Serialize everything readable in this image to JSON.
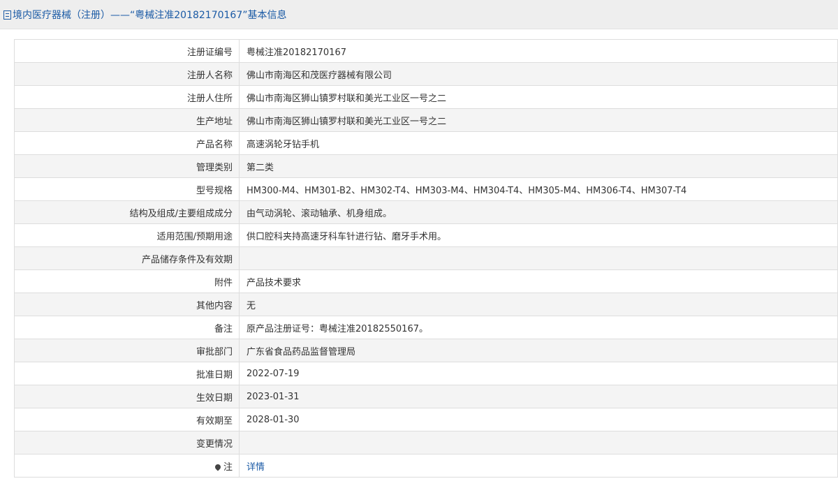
{
  "header": {
    "title": "境内医疗器械（注册）——“粤械注准20182170167”基本信息"
  },
  "rows": [
    {
      "label": "注册证编号",
      "value": "粤械注准20182170167"
    },
    {
      "label": "注册人名称",
      "value": "佛山市南海区和茂医疗器械有限公司"
    },
    {
      "label": "注册人住所",
      "value": "佛山市南海区狮山镇罗村联和美光工业区一号之二"
    },
    {
      "label": "生产地址",
      "value": "佛山市南海区狮山镇罗村联和美光工业区一号之二"
    },
    {
      "label": "产品名称",
      "value": "高速涡轮牙钻手机"
    },
    {
      "label": "管理类别",
      "value": "第二类"
    },
    {
      "label": "型号规格",
      "value": "HM300-M4、HM301-B2、HM302-T4、HM303-M4、HM304-T4、HM305-M4、HM306-T4、HM307-T4"
    },
    {
      "label": "结构及组成/主要组成成分",
      "value": "由气动涡轮、滚动轴承、机身组成。"
    },
    {
      "label": "适用范围/预期用途",
      "value": "供口腔科夹持高速牙科车针进行钻、磨牙手术用。"
    },
    {
      "label": "产品储存条件及有效期",
      "value": ""
    },
    {
      "label": "附件",
      "value": "产品技术要求"
    },
    {
      "label": "其他内容",
      "value": "无"
    },
    {
      "label": "备注",
      "value": "原产品注册证号：粤械注准20182550167。"
    },
    {
      "label": "审批部门",
      "value": "广东省食品药品监督管理局"
    },
    {
      "label": "批准日期",
      "value": "2022-07-19"
    },
    {
      "label": "生效日期",
      "value": "2023-01-31"
    },
    {
      "label": "有效期至",
      "value": "2028-01-30"
    },
    {
      "label": "变更情况",
      "value": ""
    }
  ],
  "note_row": {
    "label": "注",
    "link_label": "详情"
  }
}
